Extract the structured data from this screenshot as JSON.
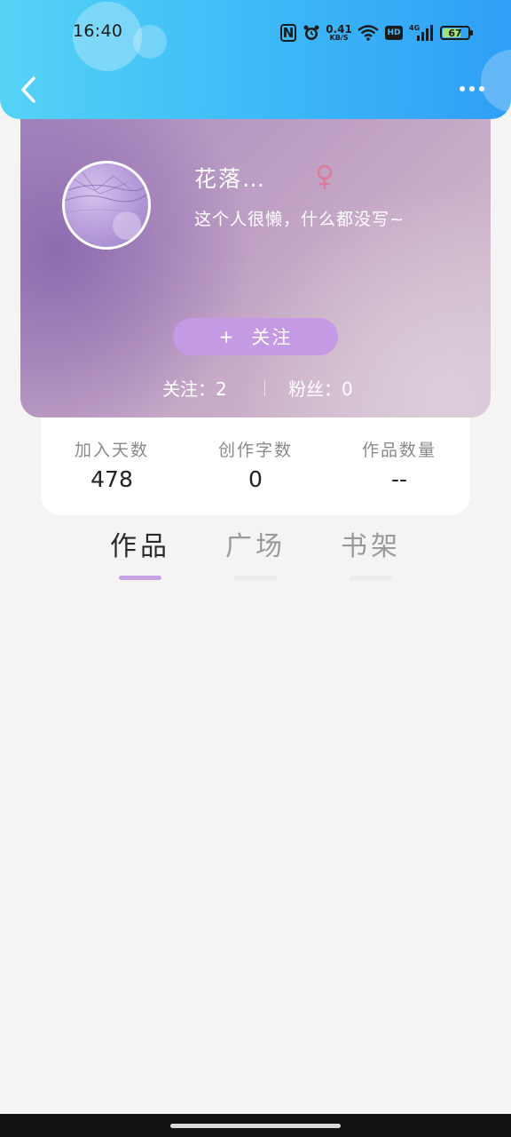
{
  "status_bar": {
    "time": "16:40",
    "network_speed_value": "0.41",
    "network_speed_unit": "KB/S",
    "hd_label": "HD",
    "signal_label": "4G",
    "battery_level": "67"
  },
  "header": {
    "back_icon": "chevron-left-icon",
    "more_icon": "more-dots-icon"
  },
  "profile": {
    "username": "花落…",
    "gender_symbol": "♀",
    "bio": "这个人很懒，什么都没写~",
    "follow_button": {
      "plus": "+",
      "label": "关注"
    },
    "following": "关注：2",
    "fans": "粉丝：0"
  },
  "stats": [
    {
      "label": "加入天数",
      "value": "478"
    },
    {
      "label": "创作字数",
      "value": "0"
    },
    {
      "label": "作品数量",
      "value": "--"
    }
  ],
  "tabs": [
    {
      "label": "作品",
      "active": true
    },
    {
      "label": "广场",
      "active": false
    },
    {
      "label": "书架",
      "active": false
    }
  ],
  "colors": {
    "header_gradient_start": "#55d3f6",
    "header_gradient_end": "#2f9ff6",
    "accent_purple": "#c49ae5",
    "tab_underline_active": "#c8a3e4",
    "gender_icon": "#e07a9a",
    "background": "#f4f4f4"
  }
}
